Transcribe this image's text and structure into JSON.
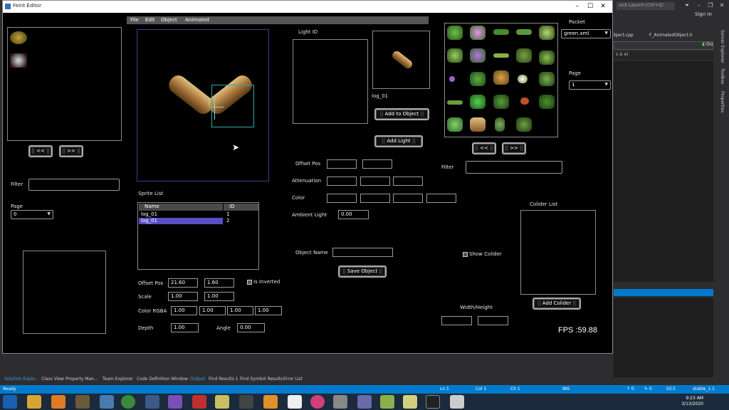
{
  "vs": {
    "quick_launch": "uick Launch (Ctrl+Q)",
    "sign_in": "Sign in",
    "tab_a": "bject.cpp",
    "tab_b": "F_AnimatedObject.h",
    "go_label": "Go",
    "field2_text": "s & e)",
    "right_strip": [
      "Server Explorer",
      "Toolbox",
      "Properties"
    ],
    "bottom_tabs": [
      "Solution Explo...",
      "Class View",
      "Property Man...",
      "Team Explorer",
      "Code Definition Window",
      "Output",
      "Find Results 1",
      "Find Symbol Results",
      "Error List"
    ],
    "status": {
      "ready": "Ready",
      "ln": "Ln 1",
      "col": "Col 1",
      "ch": "Ch 1",
      "ins": "INS",
      "up": "↑ 0",
      "pencil": "✎ 0",
      "repo": "GC3",
      "branch": "stable_1.1"
    },
    "clock": {
      "time": "9:23 AM",
      "date": "3/13/2020"
    }
  },
  "window": {
    "title": "Feint Editor"
  },
  "menu": [
    "File",
    "Edit",
    "Object",
    "Animated"
  ],
  "left": {
    "prev": "<<",
    "next": ">>",
    "filter_label": "Filter",
    "filter_value": "",
    "page_label": "Page",
    "page_value": "0"
  },
  "sprite_list": {
    "title": "Sprite List",
    "headers": [
      "Name",
      "ID"
    ],
    "rows": [
      {
        "name": "log_01",
        "id": "1"
      },
      {
        "name": "log_01",
        "id": "2"
      }
    ]
  },
  "transform": {
    "offset_label": "Offset Pos",
    "offset_x": "21.60",
    "offset_y": "1.60",
    "inverted_label": "Is Inverted",
    "scale_label": "Scale",
    "scale_x": "1.00",
    "scale_y": "1.00",
    "color_label": "Color RGBA",
    "r": "1.00",
    "g": "1.00",
    "b": "1.00",
    "a": "1.00",
    "depth_label": "Depth",
    "depth": "1.00",
    "angle_label": "Angle",
    "angle": "0.00"
  },
  "light": {
    "title": "Light ID",
    "sprite_name": "log_01",
    "add_to_object": "Add to Object",
    "add_light": "Add Light",
    "offset_label": "Offset Pos",
    "attenuation_label": "Attenuation",
    "color_label": "Color",
    "ambient_label": "Ambient Light",
    "ambient_value": "0.00"
  },
  "object": {
    "name_label": "Object Name",
    "name_value": "",
    "save": "Save Object"
  },
  "packet": {
    "label": "Packet",
    "value": "green.xml",
    "page_label": "Page",
    "page_value": "1",
    "prev": "<<",
    "next": ">>",
    "filter_label": "Filter"
  },
  "collider": {
    "show_label": "Show Colider",
    "list_title": "Colider List",
    "add": "Add Colider",
    "wh_label": "Width/Height"
  },
  "fps": "FPS :59.88",
  "colors": {
    "selected_row": "#5b4fc4",
    "vs_blue": "#007acc",
    "panel_border": "#8a8a8a"
  }
}
